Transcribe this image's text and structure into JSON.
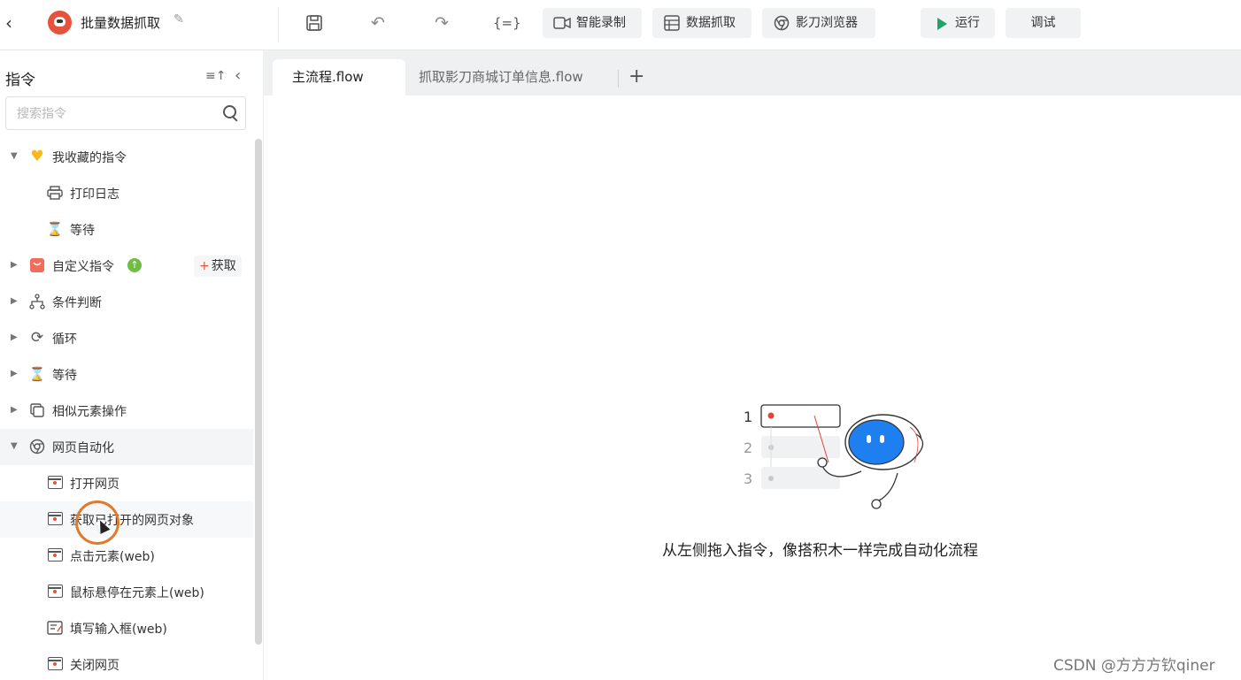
{
  "topbar": {
    "project_title": "批量数据抓取",
    "buttons": {
      "smart_record": "智能录制",
      "data_scrape": "数据抓取",
      "browser": "影刀浏览器",
      "run": "运行",
      "debug": "调试"
    },
    "icons": [
      "back-icon",
      "project-logo",
      "edit-icon",
      "save-icon",
      "undo-icon",
      "redo-icon",
      "variables-icon",
      "video-icon",
      "table-icon",
      "browser-icon",
      "play-icon"
    ]
  },
  "sidebar": {
    "title": "指令",
    "search_placeholder": "搜索指令",
    "acquire_label": "获取",
    "items": [
      {
        "label": "我收藏的指令",
        "icon": "heart-icon",
        "expanded": true
      },
      {
        "label": "打印日志",
        "icon": "printer-icon"
      },
      {
        "label": "等待",
        "icon": "hourglass-icon"
      },
      {
        "label": "自定义指令",
        "icon": "bag-icon"
      },
      {
        "label": "条件判断",
        "icon": "branch-icon"
      },
      {
        "label": "循环",
        "icon": "loop-icon"
      },
      {
        "label": "等待",
        "icon": "hourglass-icon"
      },
      {
        "label": "相似元素操作",
        "icon": "copy-icon"
      },
      {
        "label": "网页自动化",
        "icon": "browser-icon",
        "expanded": true
      },
      {
        "label": "打开网页",
        "icon": "webpage-icon"
      },
      {
        "label": "获取已打开的网页对象",
        "icon": "webpage-icon"
      },
      {
        "label": "点击元素(web)",
        "icon": "webpage-icon"
      },
      {
        "label": "鼠标悬停在元素上(web)",
        "icon": "webpage-icon"
      },
      {
        "label": "填写输入框(web)",
        "icon": "form-icon"
      },
      {
        "label": "关闭网页",
        "icon": "webpage-icon"
      }
    ]
  },
  "tabs": [
    {
      "label": "主流程.flow",
      "active": true
    },
    {
      "label": "抓取影刀商城订单信息.flow",
      "active": false
    }
  ],
  "canvas": {
    "illustration_steps": [
      "1",
      "2",
      "3"
    ],
    "empty_hint": "从左侧拖入指令，像搭积木一样完成自动化流程"
  },
  "watermark": "CSDN @方方方钦qiner",
  "colors": {
    "accent_red": "#e5533f",
    "run_green": "#21a366",
    "robot_blue": "#1e7ff0",
    "cursor_ring": "#e07a2c"
  }
}
